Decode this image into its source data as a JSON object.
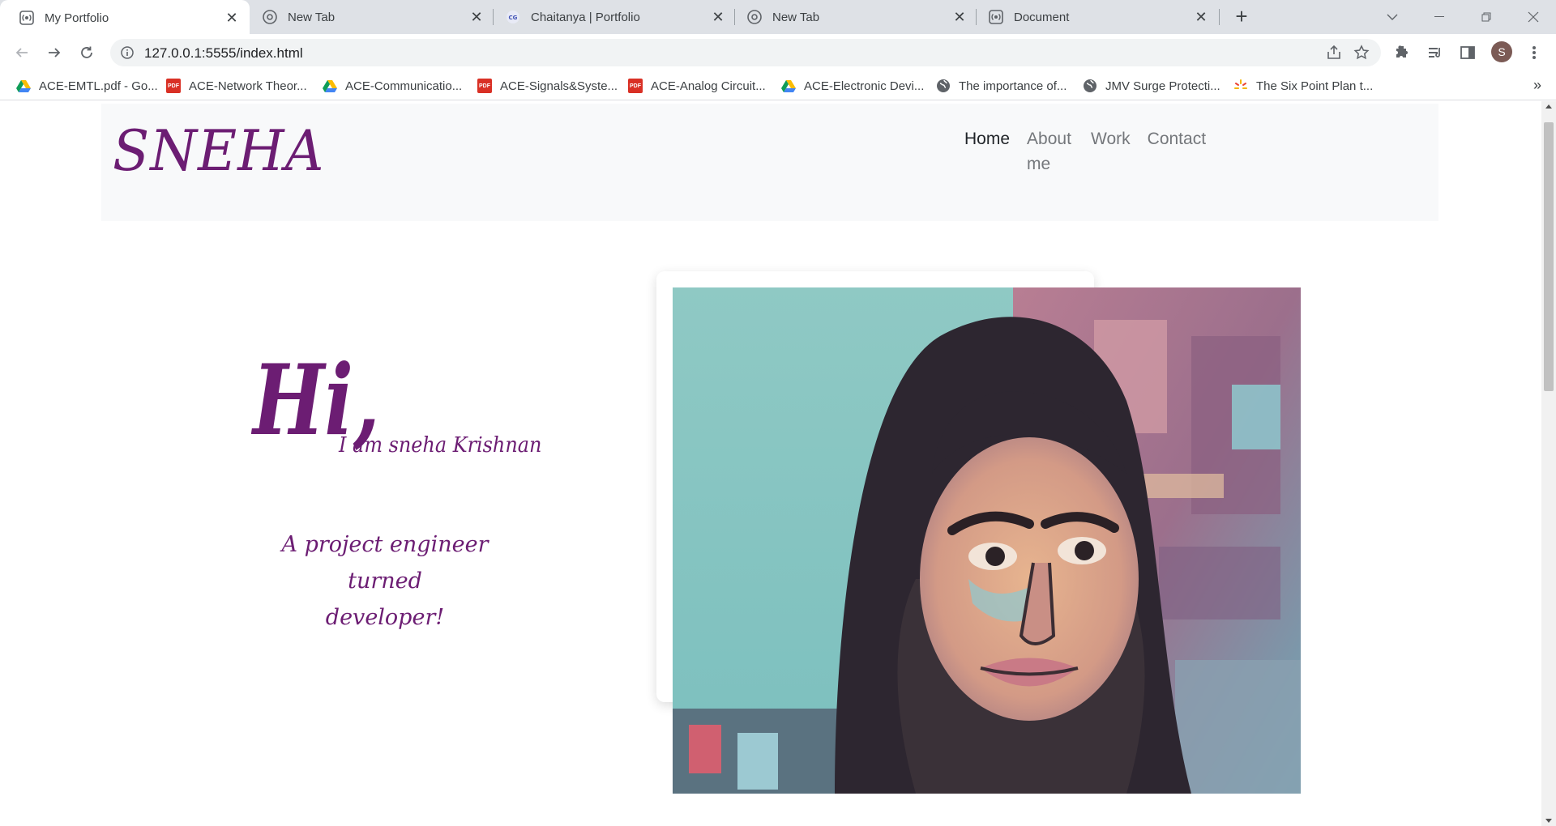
{
  "browser": {
    "tabs": [
      {
        "title": "My Portfolio",
        "active": true,
        "icon": "broadcast-icon"
      },
      {
        "title": "New Tab",
        "active": false,
        "icon": "chrome-icon"
      },
      {
        "title": "Chaitanya | Portfolio",
        "active": false,
        "icon": "cg-logo-icon"
      },
      {
        "title": "New Tab",
        "active": false,
        "icon": "chrome-icon"
      },
      {
        "title": "Document",
        "active": false,
        "icon": "broadcast-icon"
      }
    ],
    "url": "127.0.0.1:5555/index.html",
    "profile_initial": "S",
    "bookmarks": [
      {
        "label": "ACE-EMTL.pdf - Go...",
        "icon": "google-drive-icon"
      },
      {
        "label": "ACE-Network Theor...",
        "icon": "pdf-icon"
      },
      {
        "label": "ACE-Communicatio...",
        "icon": "google-drive-icon"
      },
      {
        "label": "ACE-Signals&Syste...",
        "icon": "pdf-icon"
      },
      {
        "label": "ACE-Analog Circuit...",
        "icon": "pdf-icon"
      },
      {
        "label": "ACE-Electronic Devi...",
        "icon": "google-drive-icon"
      },
      {
        "label": "The importance of...",
        "icon": "globe-icon"
      },
      {
        "label": "JMV Surge Protecti...",
        "icon": "globe-icon"
      },
      {
        "label": "The Six Point Plan t...",
        "icon": "sunburst-icon"
      }
    ],
    "pdf_badge": "PDF",
    "overflow": "»"
  },
  "page": {
    "brand": "SNEHA",
    "nav": {
      "home": "Home",
      "about_line1": "About",
      "about_line2": "me",
      "work": "Work",
      "contact": "Contact"
    },
    "hero": {
      "greeting": "Hi,",
      "intro": "I am sneha Krishnan",
      "tagline_line1": "A project engineer turned",
      "tagline_line2": "developer!"
    },
    "colors": {
      "brand_purple": "#6c1d73",
      "navbar_bg": "#f8f9fa"
    }
  }
}
